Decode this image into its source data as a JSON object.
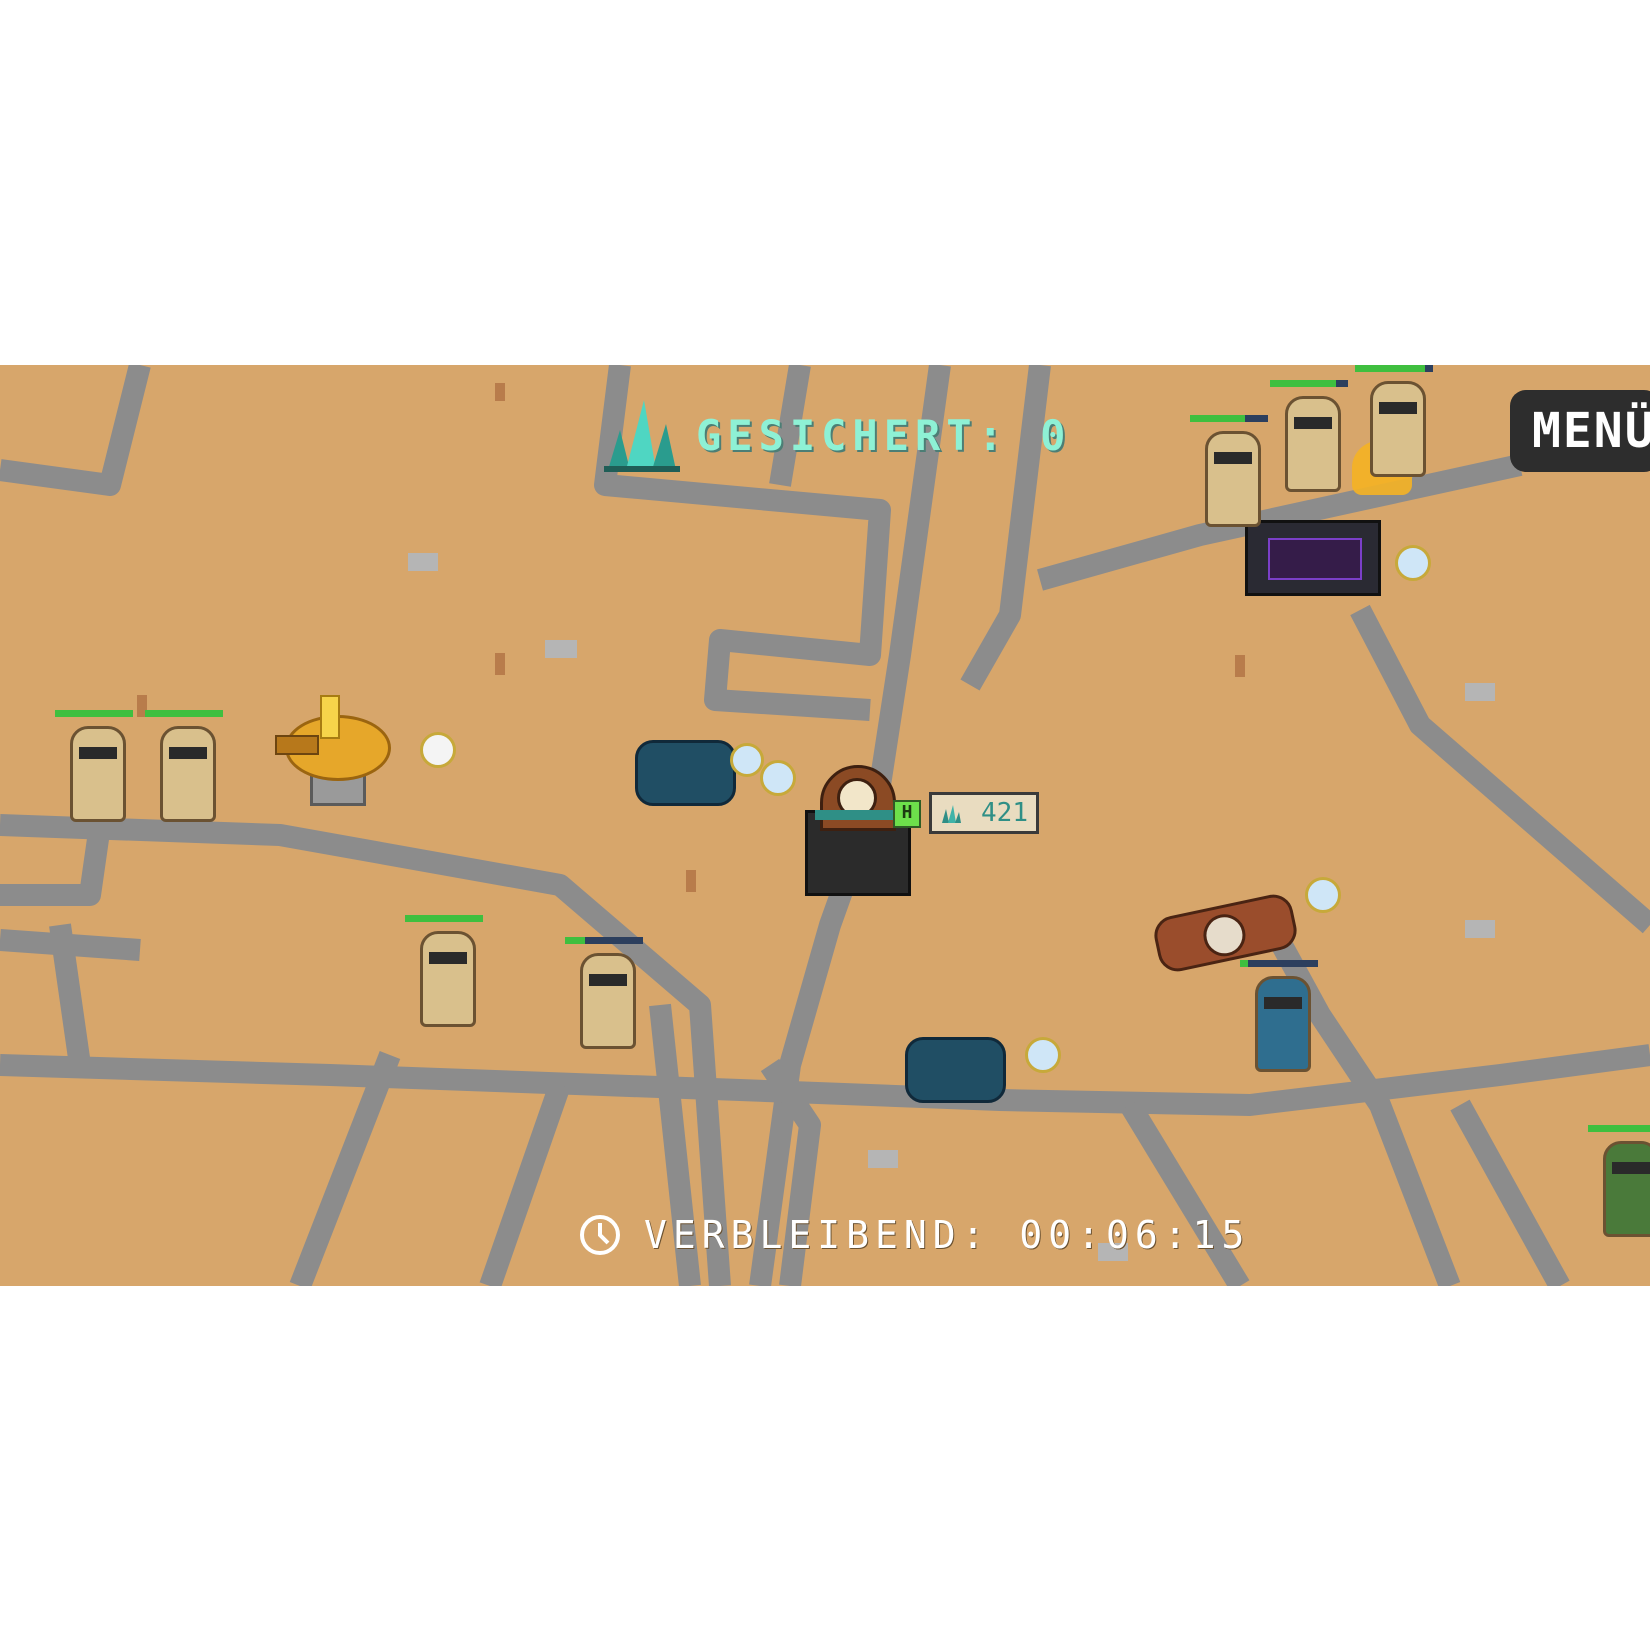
{
  "hud": {
    "saved_label": "GESICHERT: 0",
    "menu_label": "MENÜ",
    "timer_label": "VERBLEIBEND: 00:06:15",
    "tower_price": "421",
    "tower_badge": "H",
    "crystal_icon": "crystal-icon",
    "clock_icon": "clock-icon"
  },
  "enemies": [
    {
      "type": "mummy",
      "health": 1.0
    },
    {
      "type": "mummy",
      "health": 1.0
    },
    {
      "type": "mummy",
      "health": 1.0
    },
    {
      "type": "mummy",
      "health": 0.25
    },
    {
      "type": "pharaoh",
      "health": 0.1
    },
    {
      "type": "mummy",
      "health": 0.7
    },
    {
      "type": "mummy",
      "health": 0.85
    },
    {
      "type": "mummy",
      "health": 0.9
    },
    {
      "type": "green-mummy",
      "health": 1.0
    }
  ],
  "colors": {
    "sand": "#d7a66b",
    "road": "#8a8a8a",
    "hud_text": "#8ef1d5",
    "health_green": "#3fbf3f",
    "menu_bg": "#2d2d2d"
  }
}
